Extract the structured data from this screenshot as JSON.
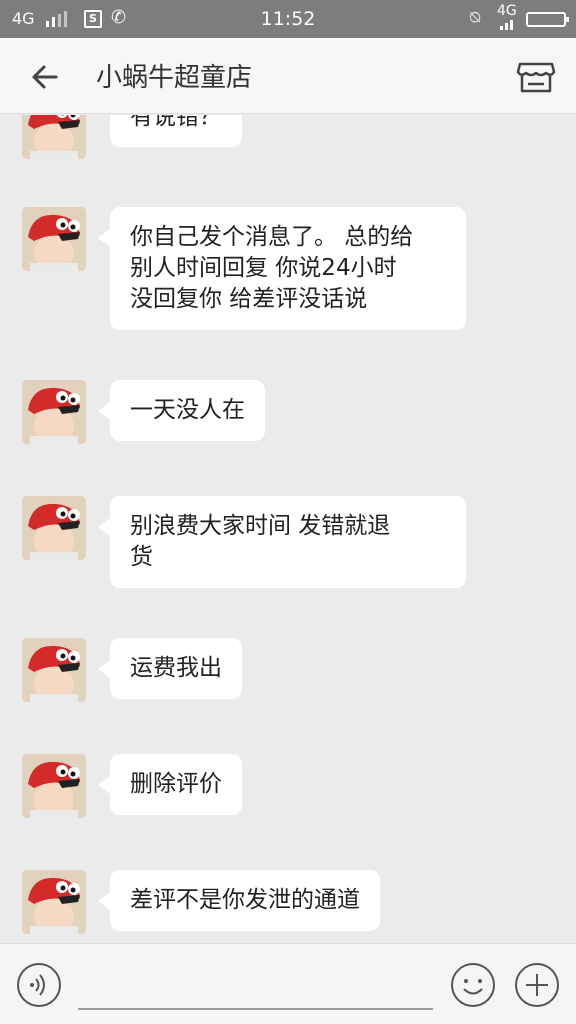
{
  "status_bar": {
    "network_left": "4G",
    "time": "11:52",
    "network_right": "4G"
  },
  "header": {
    "title": "小蜗牛超童店"
  },
  "messages": [
    {
      "text": "有说错？"
    },
    {
      "text": "你自己发个消息了。 总的给\n别人时间回复  你说24小时\n没回复你  给差评没话说"
    },
    {
      "text": "一天没人在"
    },
    {
      "text": "别浪费大家时间  发错就退\n货"
    },
    {
      "text": "运费我出"
    },
    {
      "text": "删除评价"
    },
    {
      "text": "差评不是你发泄的通道"
    }
  ],
  "colors": {
    "status_bar": "#7d7d7d",
    "header": "#f7f7f7",
    "chat_background": "#ebebeb",
    "bubble": "#ffffff",
    "avatar_hat": "#d42a2a"
  },
  "icons": {
    "back": "arrow-left",
    "store": "storefront",
    "voice": "sound-waves",
    "emoji": "smiley",
    "more": "plus"
  }
}
